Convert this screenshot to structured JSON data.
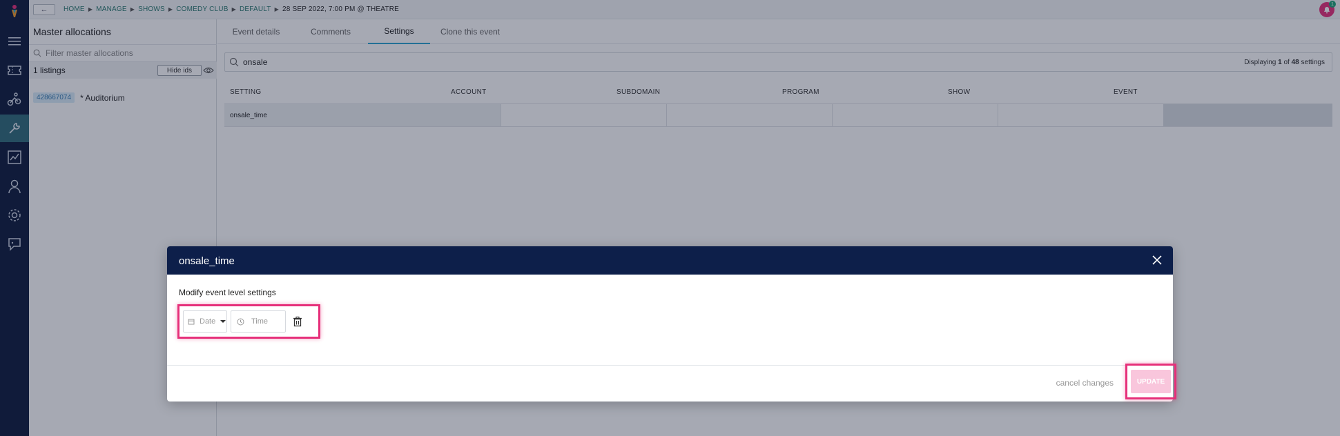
{
  "breadcrumb": {
    "items": [
      "HOME",
      "MANAGE",
      "SHOWS",
      "COMEDY CLUB",
      "DEFAULT",
      "28 SEP 2022, 7:00 PM @ THEATRE"
    ]
  },
  "master": {
    "title": "Master allocations",
    "filter_placeholder": "Filter master allocations",
    "listings_count": "1 listings",
    "hide_ids_label": "Hide ids",
    "allocation": {
      "id": "428667074",
      "name": "* Auditorium"
    }
  },
  "tabs": [
    {
      "label": "Event details"
    },
    {
      "label": "Comments"
    },
    {
      "label": "Settings"
    },
    {
      "label": "Clone this event"
    }
  ],
  "active_tab": "Settings",
  "search": {
    "value": "onsale",
    "display_prefix": "Displaying",
    "display_count": "1",
    "display_of": "of",
    "display_total": "48",
    "display_suffix": "settings"
  },
  "table": {
    "headers": [
      "SETTING",
      "ACCOUNT",
      "SUBDOMAIN",
      "PROGRAM",
      "SHOW",
      "EVENT"
    ],
    "rows": [
      {
        "setting": "onsale_time"
      }
    ]
  },
  "modal": {
    "title": "onsale_time",
    "subtitle": "Modify event level settings",
    "date_placeholder": "Date",
    "time_placeholder": "Time",
    "cancel_label": "cancel changes",
    "update_label": "UPDATE"
  },
  "notifications": {
    "count": "1"
  },
  "colors": {
    "navy": "#0d1b3d",
    "accent_pink": "#e6307a",
    "active_rail": "#2f6b7a",
    "link_teal": "#2a7a6f",
    "tab_underline": "#2aa3d0"
  }
}
